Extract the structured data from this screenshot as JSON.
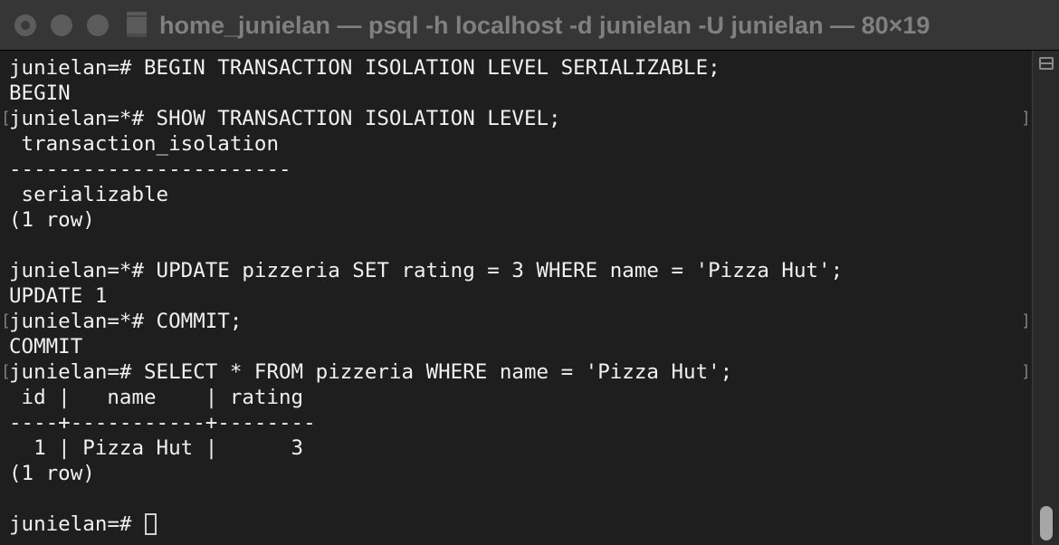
{
  "window": {
    "title": "home_junielan — psql -h localhost -d junielan -U junielan — 80×19"
  },
  "terminal": {
    "lines": [
      "junielan=# BEGIN TRANSACTION ISOLATION LEVEL SERIALIZABLE;",
      "BEGIN",
      "junielan=*# SHOW TRANSACTION ISOLATION LEVEL;",
      " transaction_isolation",
      "-----------------------",
      " serializable",
      "(1 row)",
      "",
      "junielan=*# UPDATE pizzeria SET rating = 3 WHERE name = 'Pizza Hut';",
      "UPDATE 1",
      "junielan=*# COMMIT;",
      "COMMIT",
      "junielan=# SELECT * FROM pizzeria WHERE name = 'Pizza Hut';",
      " id |   name    | rating",
      "----+-----------+--------",
      "  1 | Pizza Hut |      3",
      "(1 row)",
      "",
      "junielan=# "
    ],
    "bracket_open": "[",
    "bracket_close": "]"
  }
}
